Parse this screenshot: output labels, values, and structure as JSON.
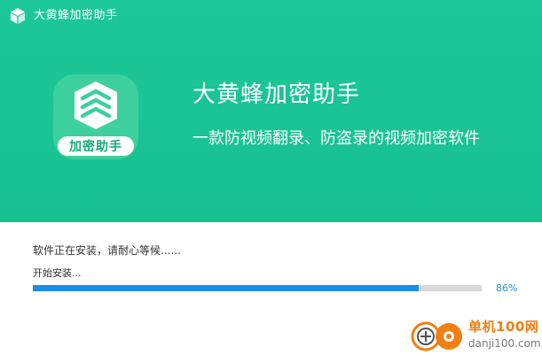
{
  "window": {
    "title": "大黄蜂加密助手",
    "icon": "cube-icon"
  },
  "hero": {
    "logo_icon": "shield-layers-icon",
    "logo_label": "加密助手",
    "product_name": "大黄蜂加密助手",
    "tagline": "一款防视频翻录、防盗录的视频加密软件"
  },
  "install": {
    "status": "软件正在安装，请耐心等候......",
    "step": "开始安装...",
    "progress": 0.86,
    "progress_label": "86%"
  },
  "watermark": {
    "site_name": "单机100网",
    "url": "danji100.com"
  },
  "colors": {
    "header_green": "#1dc897",
    "progress_blue": "#1a8fe6",
    "track_gray": "#d9d9d9",
    "watermark_orange": "#f07f13"
  }
}
